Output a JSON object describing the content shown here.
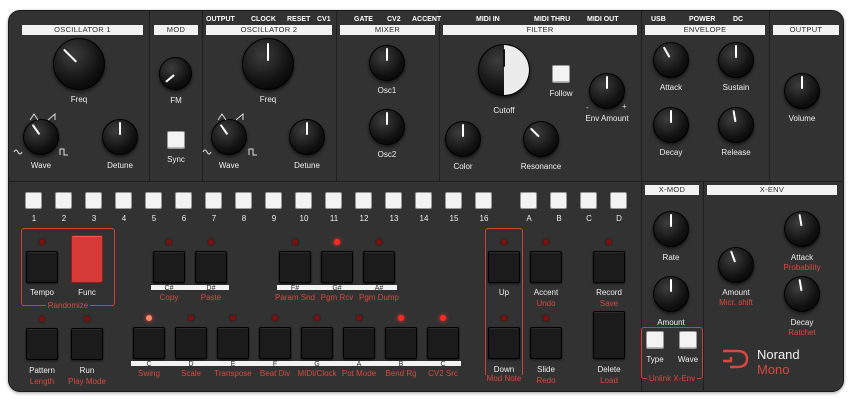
{
  "sections": {
    "osc1": "OSCILLATOR 1",
    "mod": "MOD",
    "osc2": "OSCILLATOR 2",
    "mixer": "MIXER",
    "filter": "FILTER",
    "envelope": "ENVELOPE",
    "output": "OUTPUT",
    "xmod": "X-MOD",
    "xenv": "X-ENV"
  },
  "jacks": [
    "OUTPUT",
    "CLOCK",
    "RESET",
    "CV1",
    "GATE",
    "CV2",
    "ACCENT",
    "MIDI IN",
    "MIDI THRU",
    "MIDI OUT",
    "USB",
    "POWER",
    "DC"
  ],
  "knobs": {
    "osc1_freq": "Freq",
    "osc1_wave": "Wave",
    "osc1_detune": "Detune",
    "fm": "FM",
    "osc2_freq": "Freq",
    "osc2_wave": "Wave",
    "osc2_detune": "Detune",
    "osc1_mix": "Osc1",
    "osc2_mix": "Osc2",
    "cutoff": "Cutoff",
    "color": "Color",
    "resonance": "Resonance",
    "env_amount": "Env Amount",
    "attack": "Attack",
    "sustain": "Sustain",
    "decay": "Decay",
    "release": "Release",
    "volume": "Volume",
    "xmod_rate": "Rate",
    "xmod_amount": "Amount",
    "xenv_amount": "Amount",
    "xenv_attack": "Attack",
    "xenv_decay": "Decay"
  },
  "buttons": {
    "sync": "Sync",
    "follow": "Follow",
    "tempo": "Tempo",
    "func": "Func",
    "pattern": "Pattern",
    "run": "Run",
    "up": "Up",
    "down": "Down",
    "accent": "Accent",
    "slide": "Slide",
    "record": "Record",
    "delete": "Delete",
    "type": "Type",
    "wave": "Wave"
  },
  "steps": [
    "1",
    "2",
    "3",
    "4",
    "5",
    "6",
    "7",
    "8",
    "9",
    "10",
    "11",
    "12",
    "13",
    "14",
    "15",
    "16",
    "A",
    "B",
    "C",
    "D"
  ],
  "sharps": [
    "C#",
    "D#",
    "F#",
    "G#",
    "A#"
  ],
  "naturals": [
    "C",
    "D",
    "E",
    "F",
    "G",
    "A",
    "B",
    "C"
  ],
  "functions": {
    "randomize": "Randomize",
    "copy": "Copy",
    "paste": "Paste",
    "param_snd": "Param Snd",
    "pgm_rcv": "Pgm Rcv",
    "pgm_dump": "Pgm Dump",
    "length": "Length",
    "play_mode": "Play Mode",
    "swing": "Swing",
    "scale": "Scale",
    "transpose": "Transpose",
    "beat_div": "Beat Div",
    "midi_clock": "MIDI/Clock",
    "pot_mode": "Pot Mode",
    "bend_rg": "Bend Rg",
    "cv2_src": "CV2 Src",
    "mod_note": "Mod Note",
    "undo": "Undo",
    "redo": "Redo",
    "save": "Save",
    "load": "Load",
    "unlink": "Unlink X-Env",
    "micr_shift": "Micr. shift",
    "probability": "Probability",
    "ratchet": "Ratchet"
  },
  "brand": {
    "name": "Norand",
    "model": "Mono"
  }
}
